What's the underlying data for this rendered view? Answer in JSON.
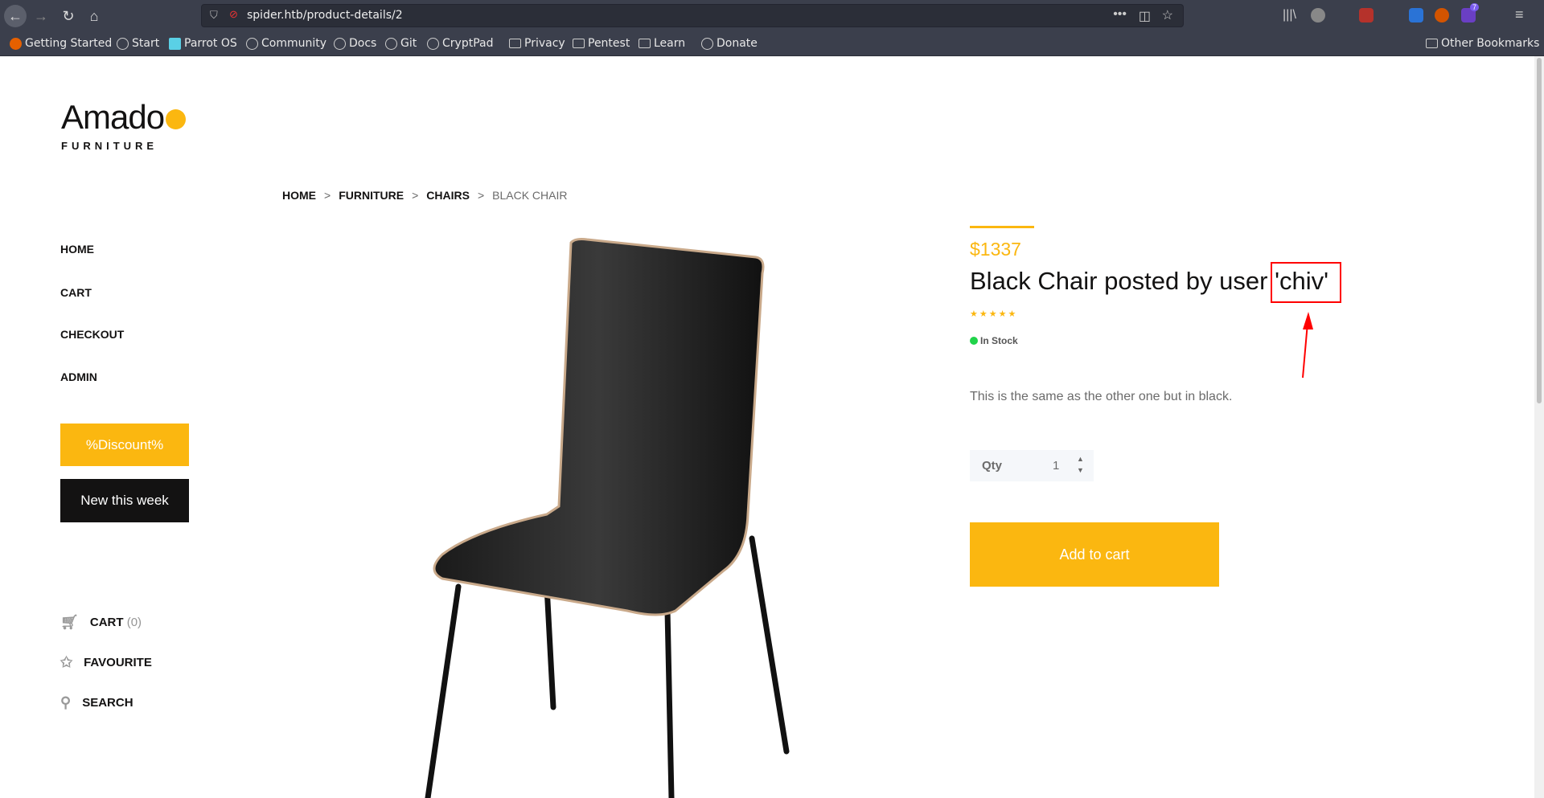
{
  "browser": {
    "url": "spider.htb/product-details/2",
    "bookmarks": [
      "Getting Started",
      "Start",
      "Parrot OS",
      "Community",
      "Docs",
      "Git",
      "CryptPad",
      "Privacy",
      "Pentest",
      "Learn",
      "Donate"
    ],
    "other_bookmarks": "Other Bookmarks",
    "ext_badge": "7"
  },
  "logo": {
    "name": "Amado",
    "sub": "FURNITURE"
  },
  "breadcrumb": [
    "HOME",
    "FURNITURE",
    "CHAIRS",
    "BLACK CHAIR"
  ],
  "breadcrumb_sep": ">",
  "nav": [
    "HOME",
    "CART",
    "CHECKOUT",
    "ADMIN"
  ],
  "buttons": {
    "discount": "%Discount%",
    "new_week": "New this week"
  },
  "side": {
    "cart": "CART",
    "cart_count": "(0)",
    "favourite": "FAVOURITE",
    "search": "SEARCH"
  },
  "product": {
    "price": "$1337",
    "title_prefix": "Black Chair posted by user ",
    "title_user": "'chiv'",
    "rating": 5,
    "stars": "★★★★★",
    "stock": "In Stock",
    "description": "This is the same as the other one but in black.",
    "qty_label": "Qty",
    "qty_value": "1",
    "add_to_cart": "Add to cart"
  },
  "colors": {
    "accent": "#fbb710",
    "annotation": "#ff0000"
  }
}
